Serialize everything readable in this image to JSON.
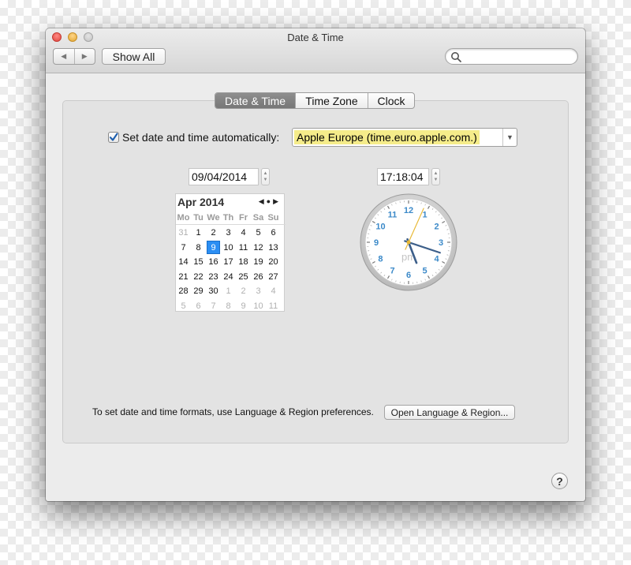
{
  "window": {
    "title": "Date & Time"
  },
  "toolbar": {
    "back_icon": "◀",
    "forward_icon": "▶",
    "show_all_label": "Show All",
    "search_value": "",
    "search_placeholder": ""
  },
  "tabs": [
    {
      "label": "Date & Time",
      "selected": true
    },
    {
      "label": "Time Zone",
      "selected": false
    },
    {
      "label": "Clock",
      "selected": false
    }
  ],
  "auto_set": {
    "checked": true,
    "label": "Set date and time automatically:",
    "server": "Apple Europe (time.euro.apple.com.)"
  },
  "date_field": "09/04/2014",
  "time_field": "17:18:04",
  "calendar": {
    "month_label": "Apr 2014",
    "weekdays": [
      "Mo",
      "Tu",
      "We",
      "Th",
      "Fr",
      "Sa",
      "Su"
    ],
    "cells": [
      [
        "31",
        true
      ],
      [
        "1",
        false
      ],
      [
        "2",
        false
      ],
      [
        "3",
        false
      ],
      [
        "4",
        false
      ],
      [
        "5",
        false
      ],
      [
        "6",
        false
      ],
      [
        "7",
        false
      ],
      [
        "8",
        false
      ],
      [
        "9",
        false
      ],
      [
        "10",
        false
      ],
      [
        "11",
        false
      ],
      [
        "12",
        false
      ],
      [
        "13",
        false
      ],
      [
        "14",
        false
      ],
      [
        "15",
        false
      ],
      [
        "16",
        false
      ],
      [
        "17",
        false
      ],
      [
        "18",
        false
      ],
      [
        "19",
        false
      ],
      [
        "20",
        false
      ],
      [
        "21",
        false
      ],
      [
        "22",
        false
      ],
      [
        "23",
        false
      ],
      [
        "24",
        false
      ],
      [
        "25",
        false
      ],
      [
        "26",
        false
      ],
      [
        "27",
        false
      ],
      [
        "28",
        false
      ],
      [
        "29",
        false
      ],
      [
        "30",
        false
      ],
      [
        "1",
        true
      ],
      [
        "2",
        true
      ],
      [
        "3",
        true
      ],
      [
        "4",
        true
      ],
      [
        "5",
        true
      ],
      [
        "6",
        true
      ],
      [
        "7",
        true
      ],
      [
        "8",
        true
      ],
      [
        "9",
        true
      ],
      [
        "10",
        true
      ],
      [
        "11",
        true
      ]
    ],
    "selected_index": 9
  },
  "clock": {
    "hour": 17,
    "minute": 18,
    "second": 4,
    "ampm": "pm",
    "numerals": [
      "12",
      "1",
      "2",
      "3",
      "4",
      "5",
      "6",
      "7",
      "8",
      "9",
      "10",
      "11"
    ]
  },
  "footer": {
    "text": "To set date and time formats, use Language & Region preferences.",
    "button_label": "Open Language & Region..."
  },
  "help_label": "?",
  "colors": {
    "accent": "#2b8ef3",
    "server_highlight": "#f5ec8a",
    "clock_numerals": "#3c8ac9"
  }
}
